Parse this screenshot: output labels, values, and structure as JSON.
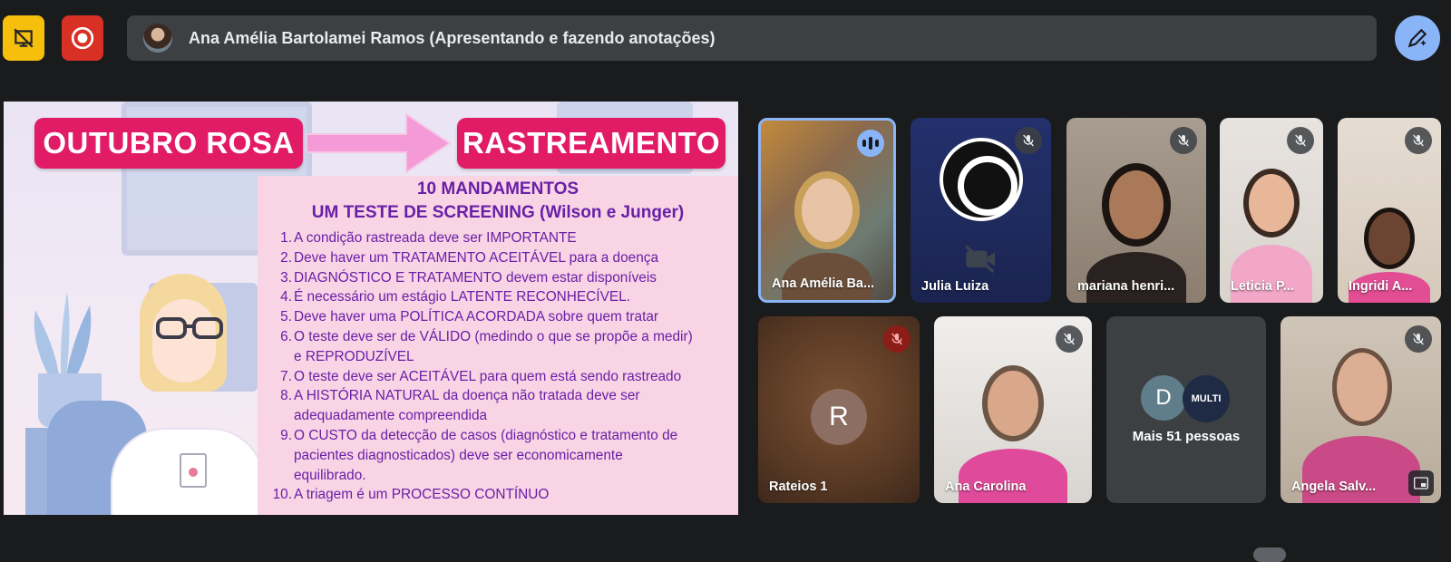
{
  "presenter": {
    "text": "Ana Amélia Bartolamei Ramos (Apresentando e fazendo anotações)"
  },
  "slide": {
    "left_title": "OUTUBRO ROSA",
    "right_title": "RASTREAMENTO",
    "heading1": "10 MANDAMENTOS",
    "heading2": "UM TESTE DE SCREENING  (Wilson e Junger)",
    "items": [
      {
        "num": "1.",
        "lines": [
          "A condição rastreada deve ser IMPORTANTE"
        ]
      },
      {
        "num": "2.",
        "lines": [
          "Deve haver um TRATAMENTO ACEITÁVEL para a doença"
        ]
      },
      {
        "num": "3.",
        "lines": [
          "DIAGNÓSTICO E TRATAMENTO devem estar disponíveis"
        ]
      },
      {
        "num": "4.",
        "lines": [
          "É necessário um estágio LATENTE RECONHECÍVEL."
        ]
      },
      {
        "num": "5.",
        "lines": [
          "Deve haver uma POLÍTICA ACORDADA sobre quem tratar"
        ]
      },
      {
        "num": "6.",
        "lines": [
          "O teste deve ser de VÁLIDO (medindo o que se propõe a medir)",
          "e REPRODUZÍVEL"
        ]
      },
      {
        "num": "7.",
        "lines": [
          "O teste deve ser ACEITÁVEL para quem está sendo rastreado"
        ]
      },
      {
        "num": "8.",
        "lines": [
          "A HISTÓRIA NATURAL da doença não tratada deve ser",
          "adequadamente compreendida"
        ]
      },
      {
        "num": "9.",
        "lines": [
          "O CUSTO da detecção de casos (diagnóstico e tratamento de",
          "pacientes diagnosticados) deve ser economicamente",
          "equilibrado."
        ]
      },
      {
        "num": "10.",
        "lines": [
          "A triagem é um PROCESSO CONTÍNUO"
        ]
      }
    ]
  },
  "participants": {
    "t1": "Ana Amélia Ba...",
    "t2": "Julia Luiza",
    "t3": "mariana henri...",
    "t4": "Leticia P...",
    "t5": "Ingridi A...",
    "t6": "Rateios 1",
    "t6_initial": "R",
    "t7": "Ana Carolina",
    "t8_initial": "D",
    "t8_logo": "MULTI",
    "t8_more": "Mais 51 pessoas",
    "t9": "Angela Salv..."
  },
  "colors": {
    "accent": "#8ab4f8",
    "slide_pink": "#e21b67",
    "slide_purple": "#6a1fa8"
  }
}
